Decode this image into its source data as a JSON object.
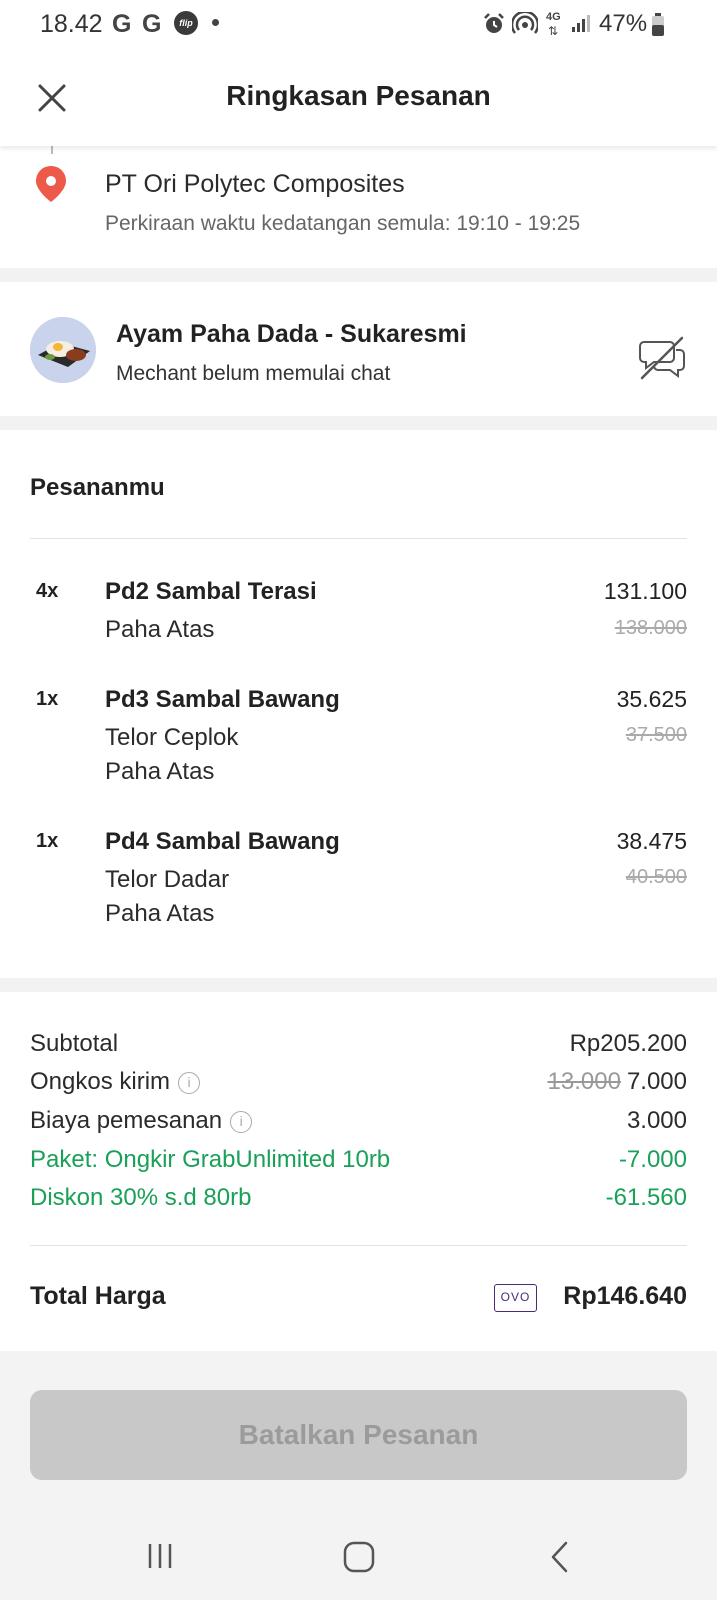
{
  "status_bar": {
    "time": "18.42",
    "notif_g1": "G",
    "notif_g2": "G",
    "notif_flip": "flip",
    "network": "4G",
    "battery": "47%"
  },
  "header": {
    "title": "Ringkasan Pesanan"
  },
  "delivery": {
    "location": "PT Ori Polytec Composites",
    "eta": "Perkiraan waktu kedatangan semula: 19:10 - 19:25"
  },
  "merchant": {
    "name": "Ayam Paha Dada - Sukaresmi",
    "chat_status": "Mechant belum memulai chat"
  },
  "orders": {
    "title": "Pesananmu",
    "items": [
      {
        "qty": "4x",
        "name": "Pd2 Sambal Terasi",
        "options": [
          "Paha Atas"
        ],
        "price": "131.100",
        "old_price": "138.000"
      },
      {
        "qty": "1x",
        "name": "Pd3 Sambal Bawang",
        "options": [
          "Telor Ceplok",
          "Paha Atas"
        ],
        "price": "35.625",
        "old_price": "37.500"
      },
      {
        "qty": "1x",
        "name": "Pd4 Sambal Bawang",
        "options": [
          "Telor Dadar",
          "Paha Atas"
        ],
        "price": "38.475",
        "old_price": "40.500"
      }
    ]
  },
  "summary": {
    "subtotal_label": "Subtotal",
    "subtotal_value": "Rp205.200",
    "delivery_label": "Ongkos kirim",
    "delivery_old": "13.000",
    "delivery_value": "7.000",
    "order_fee_label": "Biaya pemesanan",
    "order_fee_value": "3.000",
    "package_label": "Paket: Ongkir GrabUnlimited 10rb",
    "package_value": "-7.000",
    "discount_label": "Diskon 30% s.d 80rb",
    "discount_value": "-61.560",
    "total_label": "Total Harga",
    "payment_method": "OVO",
    "total_value": "Rp146.640"
  },
  "actions": {
    "cancel_label": "Batalkan Pesanan"
  },
  "colors": {
    "discount_green": "#1aa058",
    "location_pin": "#ee5a4a",
    "disabled_button": "#c8c8c8"
  }
}
